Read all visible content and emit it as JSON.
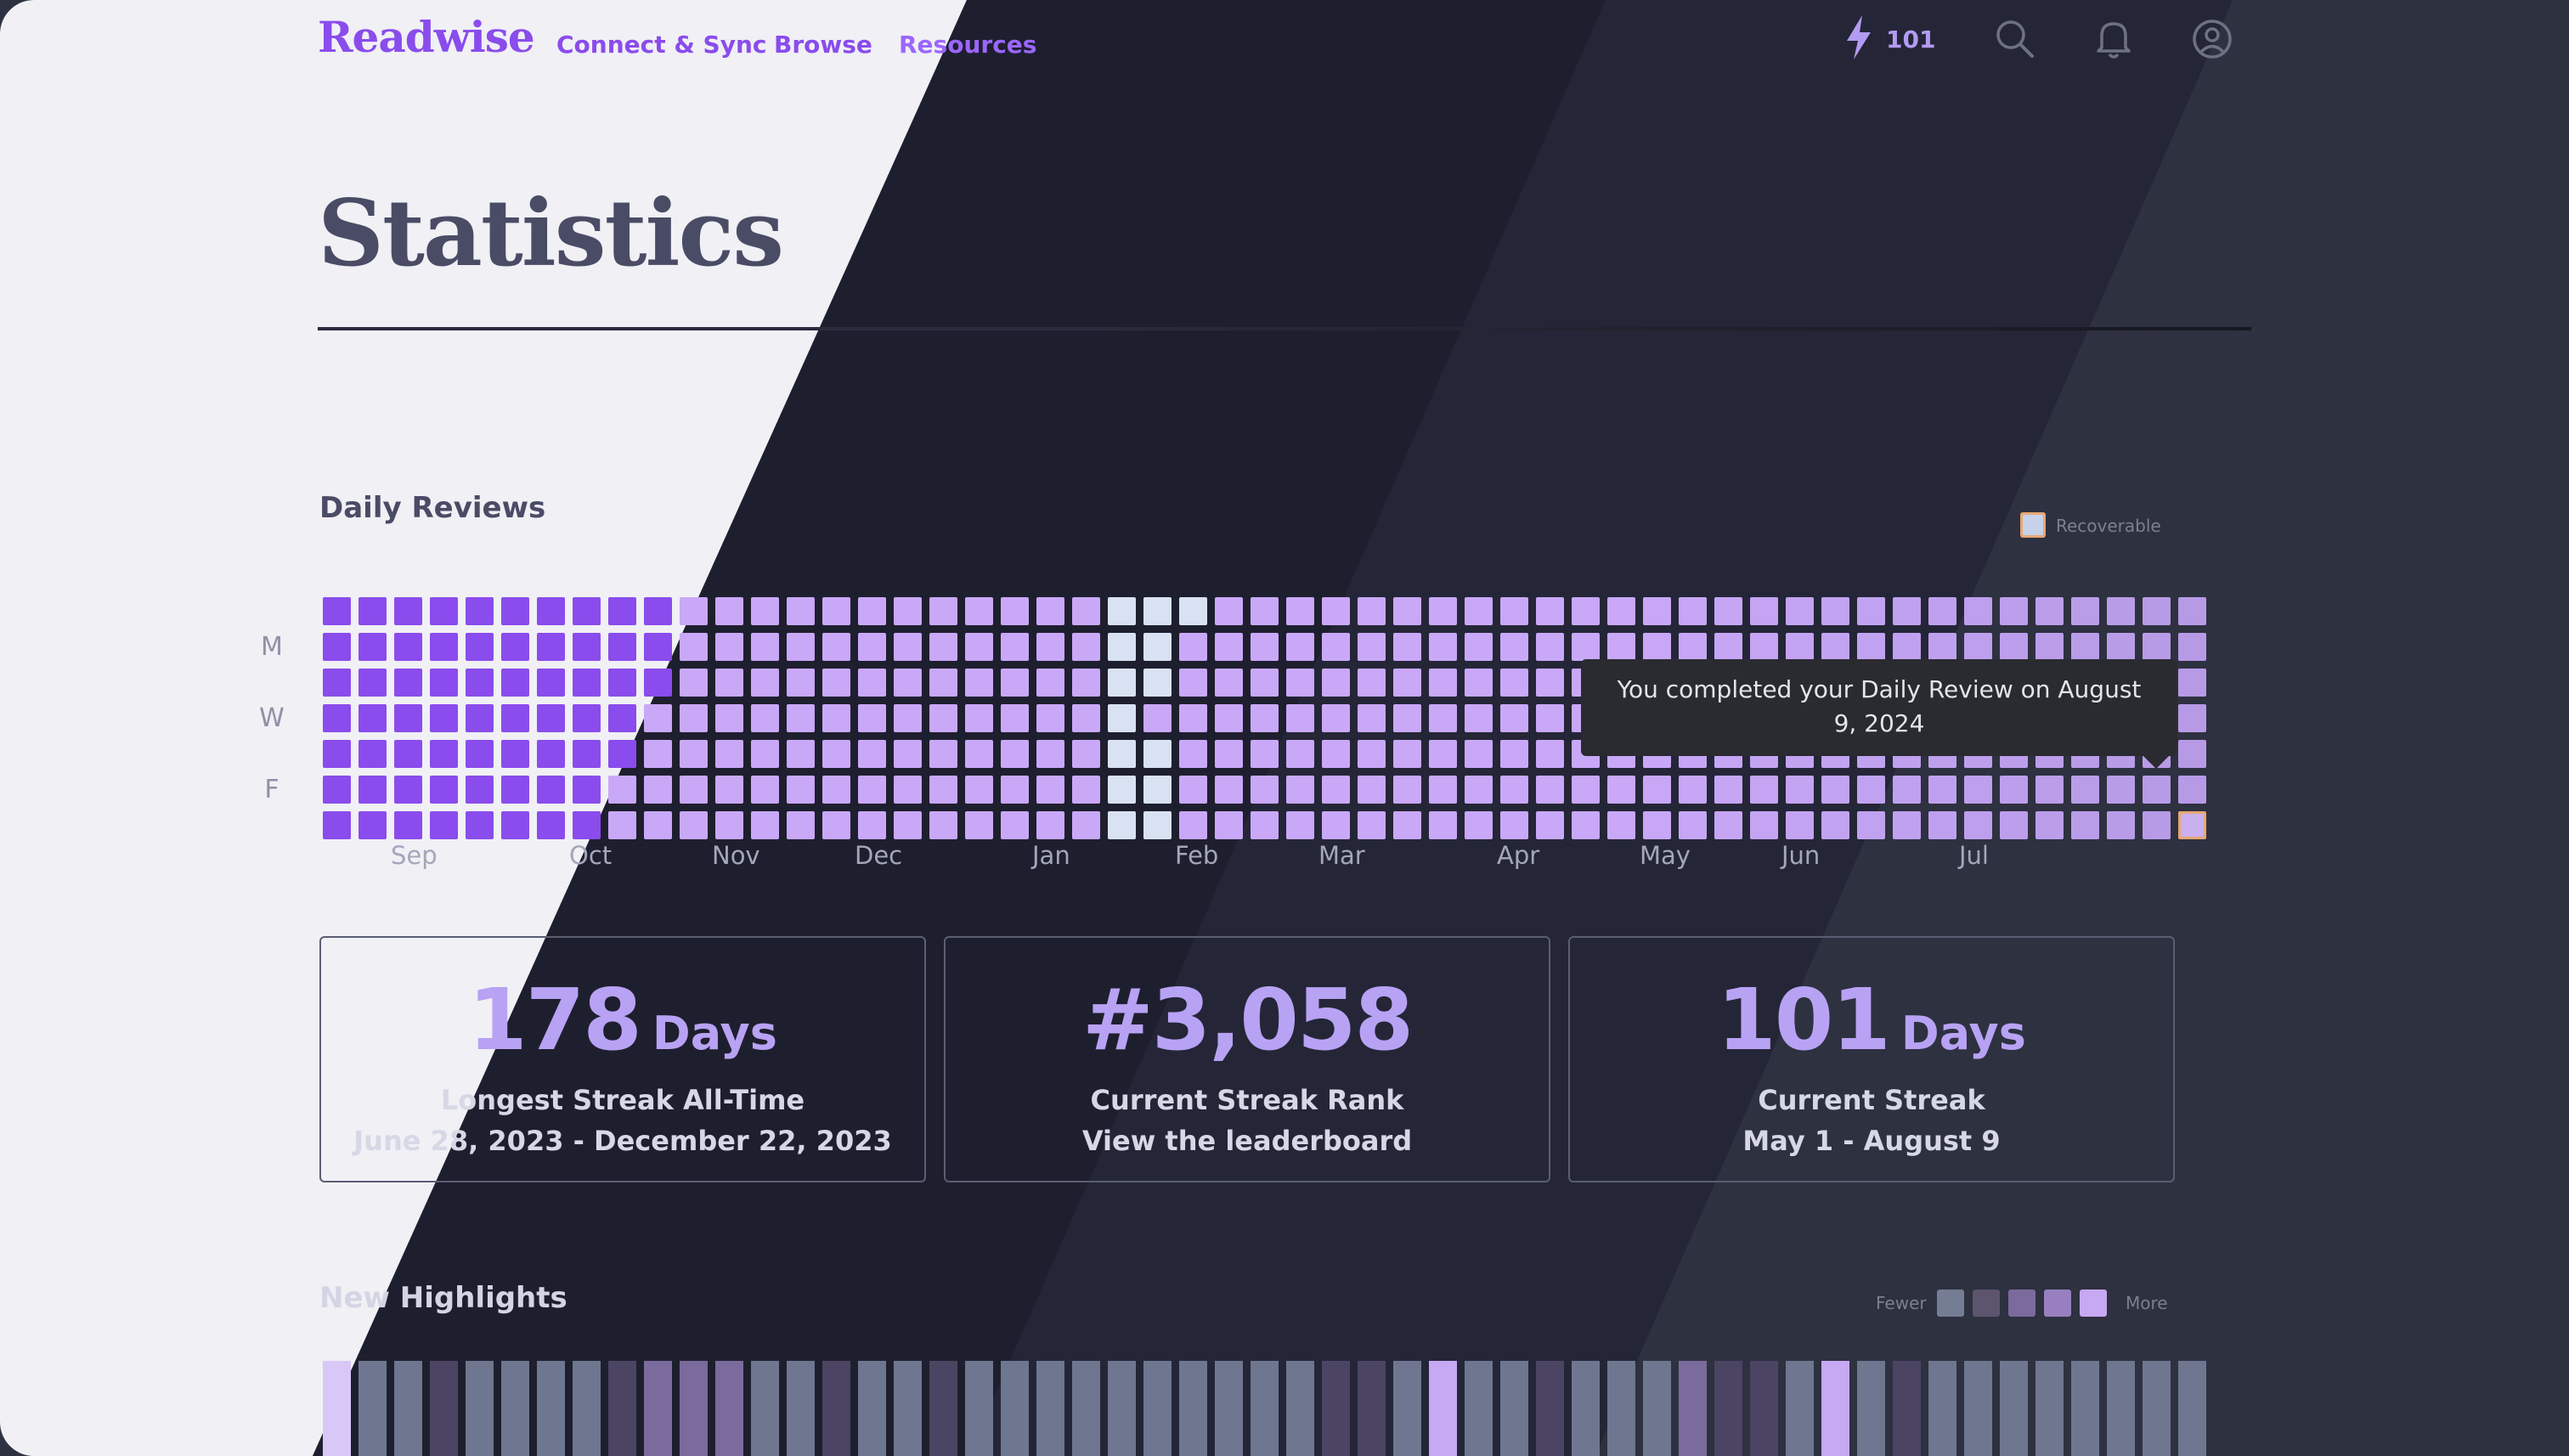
{
  "nav": {
    "logo": "Readwise",
    "links": [
      "Connect & Sync",
      "Browse",
      "Resources"
    ],
    "streak_count": "101",
    "icons": [
      "lightning-icon",
      "search-icon",
      "bell-icon",
      "account-icon"
    ]
  },
  "page": {
    "title": "Statistics"
  },
  "daily_reviews": {
    "title": "Daily Reviews",
    "legend_label": "Recoverable",
    "day_labels": [
      "M",
      "W",
      "F"
    ],
    "month_labels": [
      "Sep",
      "Oct",
      "Nov",
      "Dec",
      "Jan",
      "Feb",
      "Mar",
      "Apr",
      "May",
      "Jun",
      "Jul"
    ],
    "tooltip": "You completed your Daily Review on August 9, 2024",
    "colors": {
      "completed": "#8a4cec",
      "completed_faded": "#c9a8f8",
      "missed": "#d8e2f2",
      "recoverable_border": "#e7a774"
    }
  },
  "stats": [
    {
      "value": "178",
      "unit": "Days",
      "label": "Longest Streak All-Time",
      "sub": "June 28, 2023 - December 22, 2023"
    },
    {
      "value": "#3,058",
      "unit": "",
      "label": "Current Streak Rank",
      "sub": "View the leaderboard"
    },
    {
      "value": "101",
      "unit": "Days",
      "label": "Current Streak",
      "sub": "May 1 - August 9"
    }
  ],
  "new_highlights": {
    "title": "New Highlights",
    "legend_fewer": "Fewer",
    "legend_more": "More",
    "legend_colors": [
      "#757d94",
      "#5d546e",
      "#7b6b9c",
      "#9880c0",
      "#c7a8f2"
    ]
  }
}
